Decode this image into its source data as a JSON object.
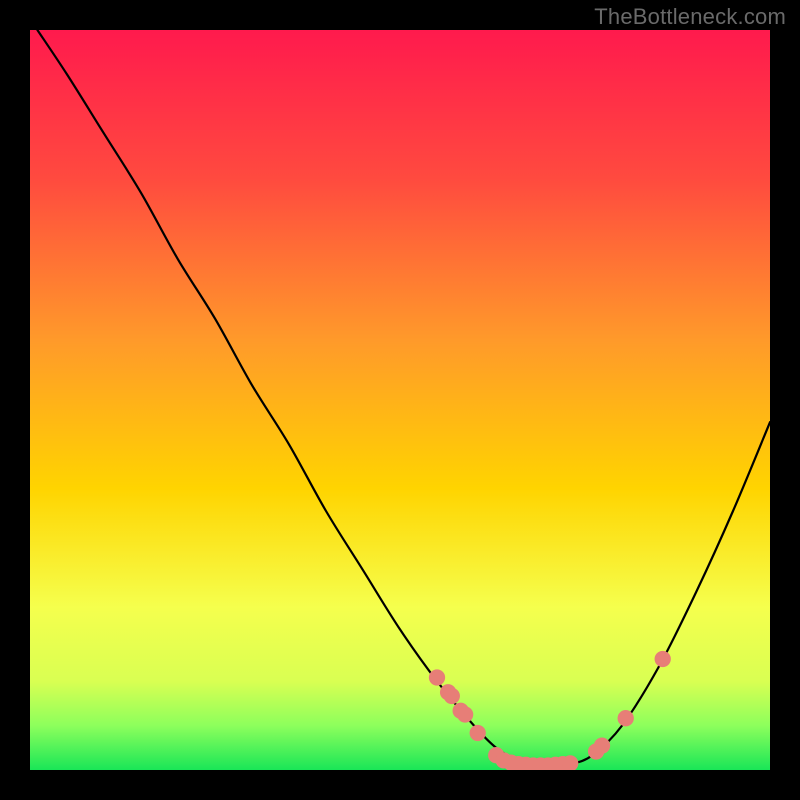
{
  "watermark": "TheBottleneck.com",
  "chart_data": {
    "type": "line",
    "title": "",
    "xlabel": "",
    "ylabel": "",
    "xlim": [
      0,
      100
    ],
    "ylim": [
      0,
      100
    ],
    "grid": false,
    "legend": false,
    "background_gradient": [
      "#ff1a4d",
      "#ff6a3a",
      "#ffd400",
      "#f5ff4d",
      "#7dff66",
      "#19e657"
    ],
    "series": [
      {
        "name": "bottleneck-curve",
        "color": "#000000",
        "x": [
          1,
          5,
          10,
          15,
          20,
          25,
          30,
          35,
          40,
          45,
          50,
          55,
          60,
          63,
          66,
          68,
          70,
          73,
          76,
          80,
          85,
          90,
          95,
          100
        ],
        "y": [
          100,
          94,
          86,
          78,
          69,
          61,
          52,
          44,
          35,
          27,
          19,
          12,
          6,
          3,
          1.2,
          0.6,
          0.6,
          0.8,
          2,
          6,
          14,
          24,
          35,
          47
        ]
      }
    ],
    "dot_markers": {
      "color": "#e77e77",
      "radius": 1.1,
      "points_xy": [
        [
          55,
          12.5
        ],
        [
          56.5,
          10.5
        ],
        [
          57,
          10.0
        ],
        [
          58.2,
          8.0
        ],
        [
          58.8,
          7.5
        ],
        [
          60.5,
          5.0
        ],
        [
          63,
          2.0
        ],
        [
          64,
          1.3
        ],
        [
          65,
          1.0
        ],
        [
          66,
          0.8
        ],
        [
          67,
          0.7
        ],
        [
          68,
          0.6
        ],
        [
          69,
          0.6
        ],
        [
          70,
          0.6
        ],
        [
          71,
          0.7
        ],
        [
          72,
          0.8
        ],
        [
          73,
          0.9
        ],
        [
          76.5,
          2.5
        ],
        [
          77.3,
          3.3
        ],
        [
          80.5,
          7.0
        ],
        [
          85.5,
          15.0
        ]
      ]
    }
  }
}
